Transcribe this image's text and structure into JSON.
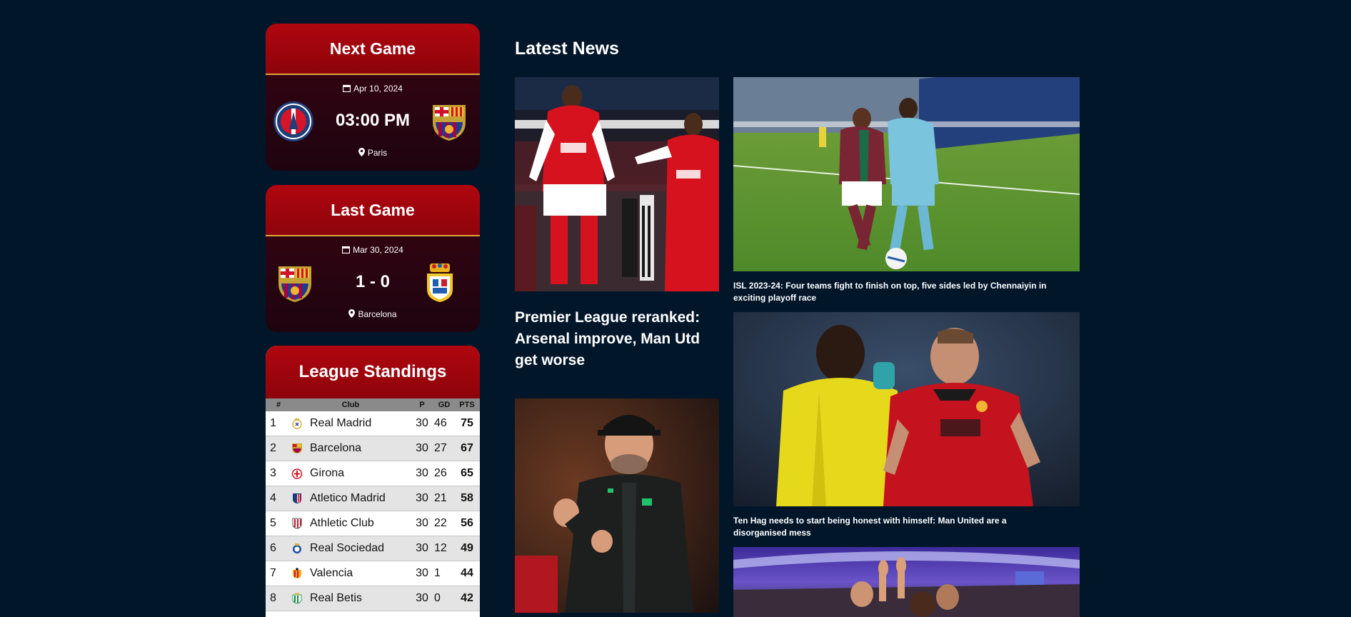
{
  "next_game": {
    "title": "Next Game",
    "date": "Apr 10, 2024",
    "time": "03:00 PM",
    "location": "Paris",
    "home_crest": "psg-crest-icon",
    "away_crest": "barcelona-crest-icon"
  },
  "last_game": {
    "title": "Last Game",
    "date": "Mar 30, 2024",
    "score": "1 - 0",
    "location": "Barcelona",
    "home_crest": "barcelona-crest-icon",
    "away_crest": "las-palmas-crest-icon"
  },
  "standings": {
    "title": "League Standings",
    "columns": [
      "#",
      "Club",
      "P",
      "GD",
      "PTS"
    ],
    "rows": [
      {
        "pos": "1",
        "club": "Real Madrid",
        "p": "30",
        "gd": "46",
        "pts": "75"
      },
      {
        "pos": "2",
        "club": "Barcelona",
        "p": "30",
        "gd": "27",
        "pts": "67"
      },
      {
        "pos": "3",
        "club": "Girona",
        "p": "30",
        "gd": "26",
        "pts": "65"
      },
      {
        "pos": "4",
        "club": "Atletico Madrid",
        "p": "30",
        "gd": "21",
        "pts": "58"
      },
      {
        "pos": "5",
        "club": "Athletic Club",
        "p": "30",
        "gd": "22",
        "pts": "56"
      },
      {
        "pos": "6",
        "club": "Real Sociedad",
        "p": "30",
        "gd": "12",
        "pts": "49"
      },
      {
        "pos": "7",
        "club": "Valencia",
        "p": "30",
        "gd": "1",
        "pts": "44"
      },
      {
        "pos": "8",
        "club": "Real Betis",
        "p": "30",
        "gd": "0",
        "pts": "42"
      }
    ]
  },
  "news": {
    "title": "Latest News",
    "featured_headline": "Premier League reranked: Arsenal improve, Man Utd get worse",
    "articles": [
      {
        "caption": "ISL 2023-24: Four teams fight to finish on top, five sides led by Chennaiyin in exciting playoff race"
      },
      {
        "caption": "Ten Hag needs to start being honest with himself: Man United are a disorganised mess"
      }
    ]
  },
  "colors": {
    "page_bg": "#02162a",
    "card_header": "#a4050e",
    "card_body": "#2a0410",
    "accent_line": "#e0a53a"
  }
}
